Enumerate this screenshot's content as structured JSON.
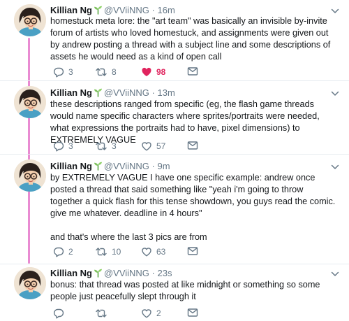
{
  "author": {
    "name": "Killian Ng",
    "handle": "@VViiNNG",
    "separator": "·"
  },
  "colors": {
    "thread_line": "#e98bd2",
    "like_active": "#e0245e",
    "muted": "#657786",
    "retweet": "#17a2a0"
  },
  "tweets": [
    {
      "time": "16m",
      "text": [
        "homestuck meta lore: the \"art team\" was basically an invisible by-invite forum of artists who loved homestuck, and assignments were given out by andrew posting a thread with a subject line and some descriptions of assets he would need as a kind of open call"
      ],
      "replies": "3",
      "retweets": "8",
      "likes": "98",
      "liked": true
    },
    {
      "time": "13m",
      "text": [
        "these descriptions ranged from specific (eg, the flash game threads would name specific characters where sprites/portraits were needed, what expressions the portraits had to have, pixel dimensions) to EXTREMELY VAGUE"
      ],
      "replies": "3",
      "retweets": "3",
      "likes": "57",
      "liked": false
    },
    {
      "time": "9m",
      "text": [
        "by EXTREMELY VAGUE I have one specific example: andrew once posted a thread that said something like \"yeah i'm going to throw together a quick flash for this tense showdown, you guys read the comic. give me whatever. deadline in 4 hours\"",
        "and that's where the last 3 pics are from"
      ],
      "replies": "2",
      "retweets": "10",
      "likes": "63",
      "liked": false
    },
    {
      "time": "23s",
      "text": [
        "bonus: that thread was posted at like midnight or something so some people just peacefully slept through it"
      ],
      "replies": "",
      "retweets": "",
      "likes": "2",
      "liked": false
    }
  ]
}
